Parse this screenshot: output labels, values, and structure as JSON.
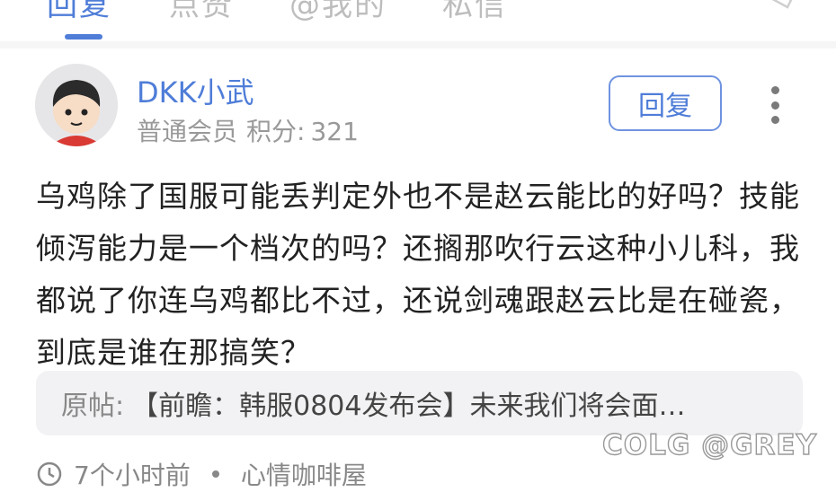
{
  "tabs": [
    {
      "label": "回复",
      "active": true
    },
    {
      "label": "点赞",
      "active": false
    },
    {
      "label": "@我的",
      "active": false
    },
    {
      "label": "私信",
      "active": false
    }
  ],
  "post": {
    "username": "DKK小武",
    "member_level": "普通会员",
    "points_label": "积分:",
    "points_value": "321",
    "reply_label": "回复",
    "content": "乌鸡除了国服可能丢判定外也不是赵云能比的好吗？技能倾泻能力是一个档次的吗？还搁那吹行云这种小儿科，我都说了你连乌鸡都比不过，还说剑魂跟赵云比是在碰瓷，到底是谁在那搞笑？",
    "quote": {
      "label": "原帖:",
      "text": "【前瞻：韩服0804发布会】未来我们将会面…"
    },
    "time": "7个小时前",
    "forum": "心情咖啡屋"
  },
  "watermark": "COLG @GREY",
  "colors": {
    "accent": "#4f7dd8",
    "text": "#222222",
    "secondary": "#999999",
    "quote_bg": "#f2f2f4"
  }
}
